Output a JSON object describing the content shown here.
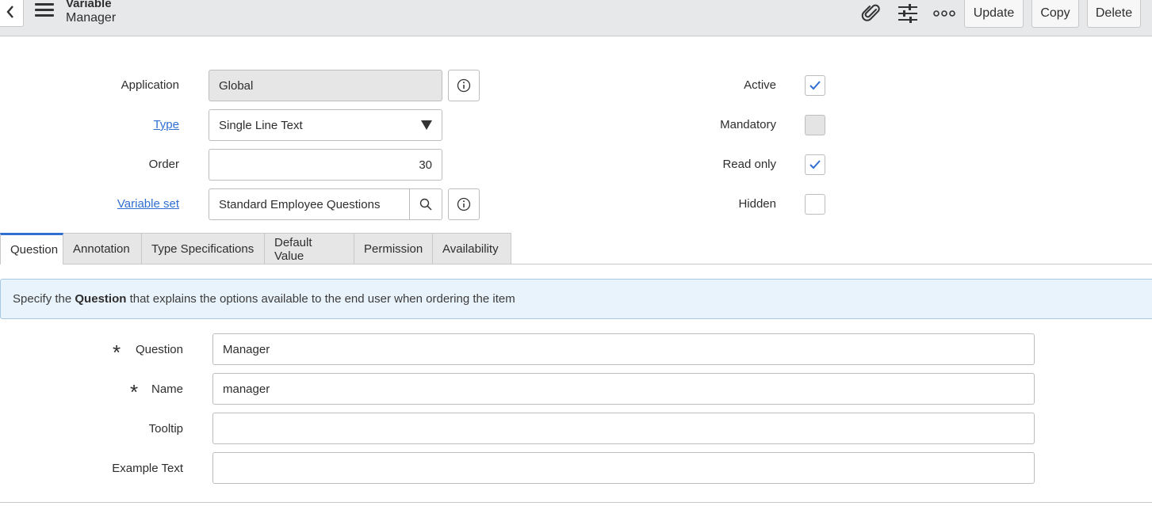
{
  "header": {
    "record_type": "Variable",
    "record_name": "Manager",
    "buttons": {
      "update": "Update",
      "copy": "Copy",
      "delete": "Delete"
    },
    "icons": [
      "back-icon",
      "menu-icon",
      "paperclip-icon",
      "settings-sliders-icon",
      "more-icon"
    ]
  },
  "form": {
    "application": {
      "label": "Application",
      "value": "Global"
    },
    "type": {
      "label": "Type",
      "value": "Single Line Text"
    },
    "order": {
      "label": "Order",
      "value": "30"
    },
    "variable_set": {
      "label": "Variable set",
      "value": "Standard Employee Questions"
    },
    "active": {
      "label": "Active",
      "checked": true
    },
    "mandatory": {
      "label": "Mandatory",
      "checked": false
    },
    "read_only": {
      "label": "Read only",
      "checked": true
    },
    "hidden": {
      "label": "Hidden",
      "checked": false
    }
  },
  "tabs": [
    "Question",
    "Annotation",
    "Type Specifications",
    "Default Value",
    "Permission",
    "Availability"
  ],
  "active_tab": "Question",
  "info": {
    "prefix": "Specify the ",
    "bold": "Question",
    "suffix": " that explains the options available to the end user when ordering the item"
  },
  "question_section": {
    "question": {
      "label": "Question",
      "value": "Manager"
    },
    "name": {
      "label": "Name",
      "value": "manager"
    },
    "tooltip": {
      "label": "Tooltip",
      "value": ""
    },
    "example_text": {
      "label": "Example Text",
      "value": ""
    }
  },
  "colors": {
    "link": "#2f6fd1",
    "check": "#2f6fd1",
    "header_bg": "#e6e8ea",
    "info_bg": "#e9f3fb"
  }
}
